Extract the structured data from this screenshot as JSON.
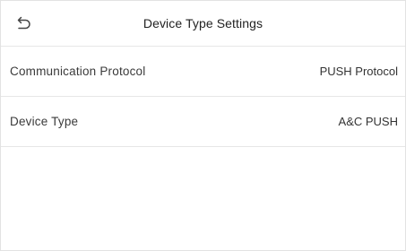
{
  "header": {
    "title": "Device Type Settings",
    "back_icon": "back-arrow-icon"
  },
  "settings": [
    {
      "label": "Communication Protocol",
      "value": "PUSH Protocol"
    },
    {
      "label": "Device Type",
      "value": "A&C PUSH"
    }
  ]
}
